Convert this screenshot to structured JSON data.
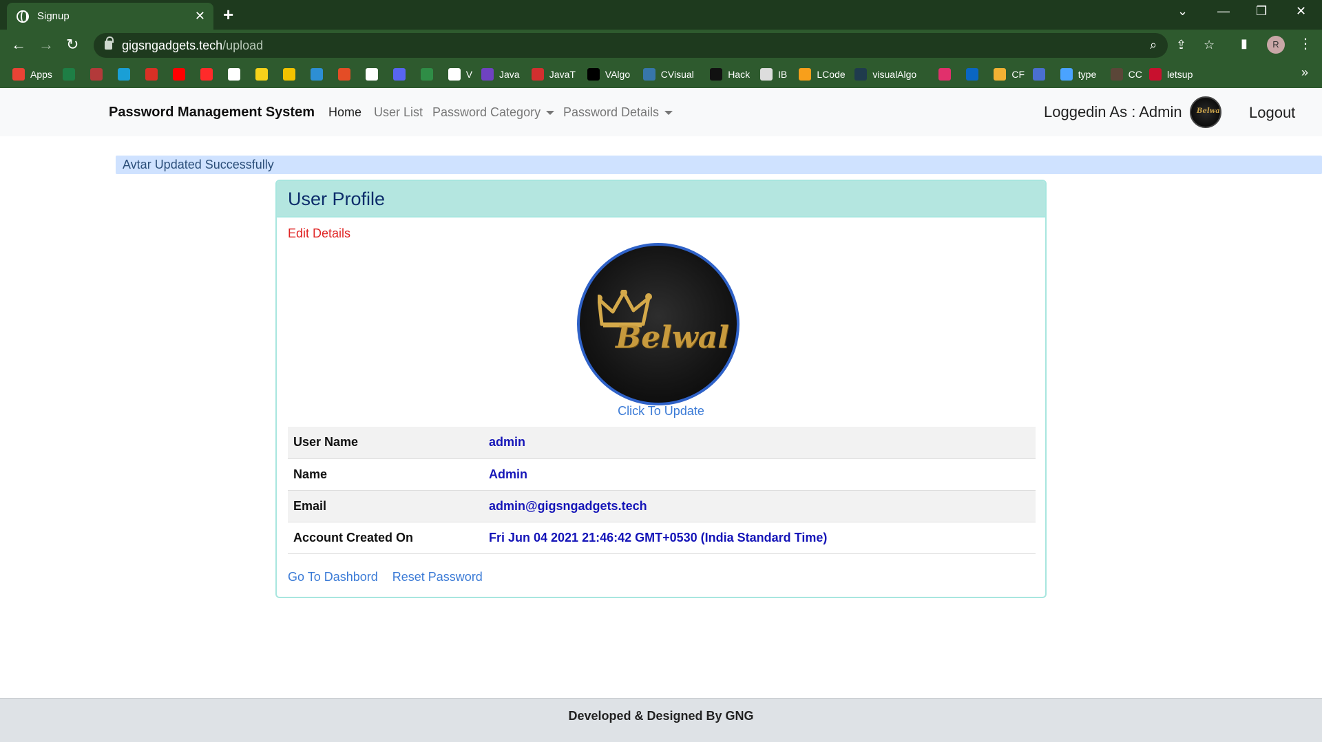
{
  "browser": {
    "tab_title": "Signup",
    "url_host": "gigsngadgets.tech",
    "url_path": "/upload",
    "profile_initial": "R",
    "bookmarks": [
      {
        "label": "Apps",
        "icon": "apps-grid-icon",
        "color": "#ea4335"
      },
      {
        "label": "",
        "icon": "excel-icon",
        "color": "#1e7e45"
      },
      {
        "label": "",
        "icon": "umbrella-icon",
        "color": "#b33a3a"
      },
      {
        "label": "",
        "icon": "p-logo-icon",
        "color": "#1a9fd6"
      },
      {
        "label": "",
        "icon": "gmail-icon",
        "color": "#d93025"
      },
      {
        "label": "",
        "icon": "youtube-icon",
        "color": "#ff0000"
      },
      {
        "label": "",
        "icon": "youtube-music-icon",
        "color": "#ff2a2a"
      },
      {
        "label": "",
        "icon": "amazon-icon",
        "color": "#ffffff"
      },
      {
        "label": "",
        "icon": "flipkart-icon",
        "color": "#f7d21a"
      },
      {
        "label": "",
        "icon": "p-yellow-icon",
        "color": "#f3c300"
      },
      {
        "label": "",
        "icon": "arrow-icon",
        "color": "#2d8fd4"
      },
      {
        "label": "",
        "icon": "code-icon",
        "color": "#e44d26"
      },
      {
        "label": "",
        "icon": "github-icon",
        "color": "#ffffff"
      },
      {
        "label": "",
        "icon": "discord-icon",
        "color": "#5865f2"
      },
      {
        "label": "",
        "icon": "gfg-icon",
        "color": "#2f8d46"
      },
      {
        "label": "V",
        "icon": "v-triangle-icon",
        "color": "#ffffff"
      },
      {
        "label": "Java",
        "icon": "bolt-icon",
        "color": "#6f42c1"
      },
      {
        "label": "JavaT",
        "icon": "javat-icon",
        "color": "#d32f2f"
      },
      {
        "label": "VAlgo",
        "icon": "va-icon",
        "color": "#000000"
      },
      {
        "label": "CVisual",
        "icon": "python-icon",
        "color": "#3776ab"
      },
      {
        "label": "Hack",
        "icon": "hackerrank-icon",
        "color": "#111111"
      },
      {
        "label": "IB",
        "icon": "mountain-icon",
        "color": "#dddddd"
      },
      {
        "label": "LCode",
        "icon": "leetcode-icon",
        "color": "#f89f1b"
      },
      {
        "label": "visualAlgo",
        "icon": "visualalgo-icon",
        "color": "#1f3b4d"
      },
      {
        "label": "",
        "icon": "instagram-icon",
        "color": "#e1306c"
      },
      {
        "label": "",
        "icon": "linkedin-icon",
        "color": "#0a66c2"
      },
      {
        "label": "CF",
        "icon": "codeforces-icon",
        "color": "#f2b134"
      },
      {
        "label": "",
        "icon": "link-icon",
        "color": "#4a6fd1"
      },
      {
        "label": "type",
        "icon": "typing-icon",
        "color": "#4aa3ff"
      },
      {
        "label": "CC",
        "icon": "codechef-icon",
        "color": "#5b4638"
      },
      {
        "label": "letsup",
        "icon": "letsup-icon",
        "color": "#c8102e"
      }
    ]
  },
  "navbar": {
    "brand": "Password Management System",
    "links": [
      "Home",
      "User List",
      "Password Category",
      "Password Details"
    ],
    "logged_in": "Loggedin As : Admin",
    "avatar_mini_text": "Belwal",
    "logout": "Logout"
  },
  "alert": "Avtar Updated Successfully",
  "profile": {
    "title": "User Profile",
    "edit_link": "Edit Details",
    "avatar_text": "Belwal",
    "update_link": "Click To Update",
    "rows": [
      {
        "label": "User Name",
        "value": "admin"
      },
      {
        "label": "Name",
        "value": "Admin"
      },
      {
        "label": "Email",
        "value": "admin@gigsngadgets.tech"
      },
      {
        "label": "Account Created On",
        "value": "Fri Jun 04 2021 21:46:42 GMT+0530 (India Standard Time)"
      }
    ],
    "dashboard_link": "Go To Dashbord",
    "reset_link": "Reset Password"
  },
  "footer": "Developed & Designed By GNG",
  "colors": {
    "chrome_dark": "#1e3a1e",
    "chrome": "#2e5a2e",
    "card_header": "#b4e6e0",
    "alert_bg": "#cfe2ff",
    "value_text": "#1515b8",
    "edit_link": "#e02424",
    "link": "#3a7ad6"
  }
}
